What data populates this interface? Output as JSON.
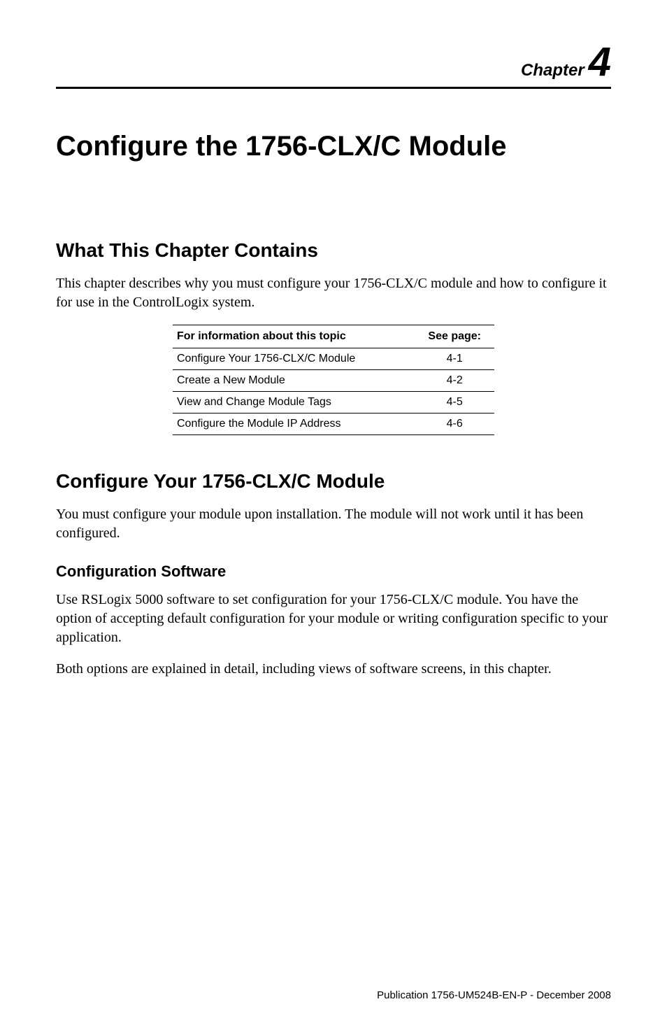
{
  "chapter": {
    "label": "Chapter",
    "number": "4"
  },
  "title": "Configure the 1756-CLX/C Module",
  "section1": {
    "heading": "What This Chapter Contains",
    "para": "This chapter describes why you must configure your 1756-CLX/C module and how to configure it for use in the ControlLogix system."
  },
  "topic_table": {
    "head_topic": "For information about this topic",
    "head_page": "See page:",
    "rows": [
      {
        "topic": "Configure Your 1756-CLX/C Module",
        "page": "4-1"
      },
      {
        "topic": "Create a New Module",
        "page": "4-2"
      },
      {
        "topic": "View and Change Module Tags",
        "page": "4-5"
      },
      {
        "topic": "Configure the Module IP Address",
        "page": "4-6"
      }
    ]
  },
  "section2": {
    "heading": "Configure Your 1756-CLX/C Module",
    "para": "You must configure your module upon installation. The module will not work until it has been configured."
  },
  "subsection": {
    "heading": "Configuration Software",
    "para1": "Use RSLogix 5000 software to set configuration for your 1756-CLX/C module. You have the option of accepting default configuration for your module or writing configuration specific to your application.",
    "para2": "Both options are explained in detail, including views of software screens, in this chapter."
  },
  "footer": "Publication 1756-UM524B-EN-P - December 2008",
  "chart_data": {
    "type": "table",
    "title": "Chapter contents index",
    "columns": [
      "For information about this topic",
      "See page:"
    ],
    "rows": [
      [
        "Configure Your 1756-CLX/C Module",
        "4-1"
      ],
      [
        "Create a New Module",
        "4-2"
      ],
      [
        "View and Change Module Tags",
        "4-5"
      ],
      [
        "Configure the Module IP Address",
        "4-6"
      ]
    ]
  }
}
